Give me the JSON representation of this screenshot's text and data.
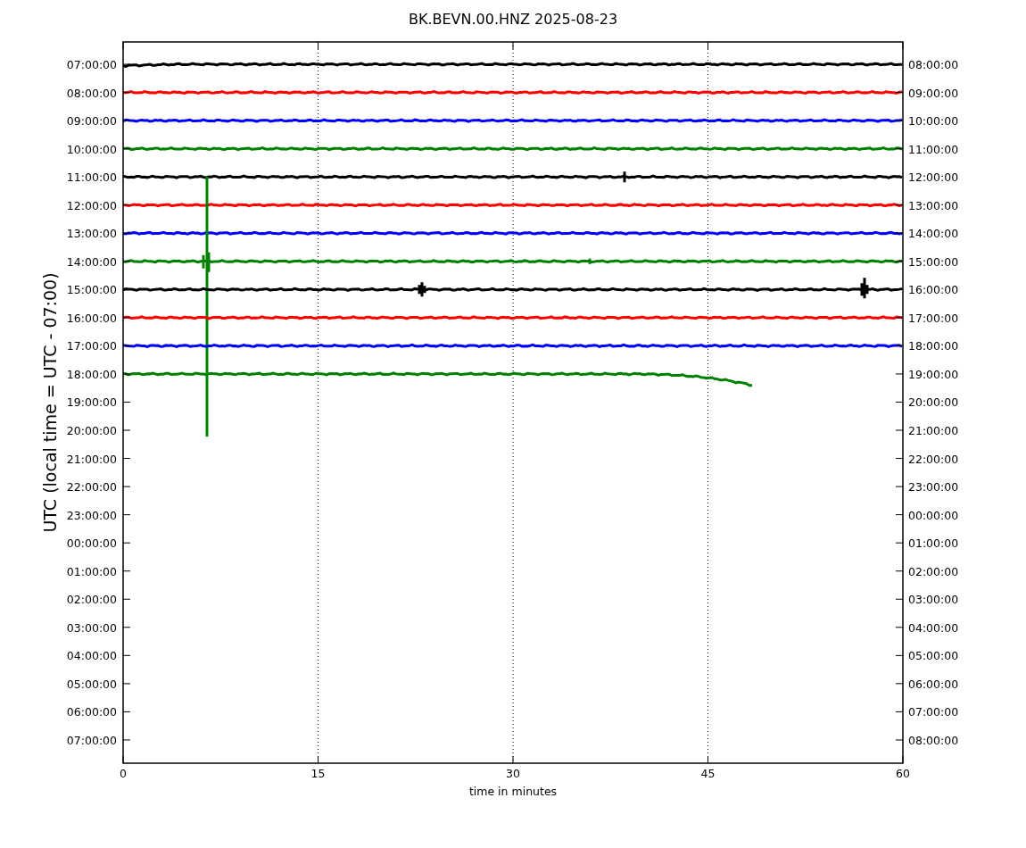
{
  "plot": {
    "title": "BK.BEVN.00.HNZ 2025-08-23",
    "ylabel": "UTC (local time = UTC - 07:00)",
    "xlabel": "time in minutes",
    "xticks": [
      "0",
      "15",
      "30",
      "45",
      "60"
    ],
    "left_labels": [
      "07:00:00",
      "08:00:00",
      "09:00:00",
      "10:00:00",
      "11:00:00",
      "12:00:00",
      "13:00:00",
      "14:00:00",
      "15:00:00",
      "16:00:00",
      "17:00:00",
      "18:00:00",
      "19:00:00",
      "20:00:00",
      "21:00:00",
      "22:00:00",
      "23:00:00",
      "00:00:00",
      "01:00:00",
      "02:00:00",
      "03:00:00",
      "04:00:00",
      "05:00:00",
      "06:00:00",
      "07:00:00"
    ],
    "right_labels": [
      "08:00:00",
      "09:00:00",
      "10:00:00",
      "11:00:00",
      "12:00:00",
      "13:00:00",
      "14:00:00",
      "15:00:00",
      "16:00:00",
      "17:00:00",
      "18:00:00",
      "19:00:00",
      "20:00:00",
      "21:00:00",
      "22:00:00",
      "23:00:00",
      "00:00:00",
      "01:00:00",
      "02:00:00",
      "03:00:00",
      "04:00:00",
      "05:00:00",
      "06:00:00",
      "07:00:00",
      "08:00:00"
    ],
    "traces": [
      {
        "color": "#000000"
      },
      {
        "color": "#ff0000"
      },
      {
        "color": "#0000ff"
      },
      {
        "color": "#008000"
      },
      {
        "color": "#000000"
      },
      {
        "color": "#ff0000"
      },
      {
        "color": "#0000ff"
      },
      {
        "color": "#008000"
      },
      {
        "color": "#000000"
      },
      {
        "color": "#ff0000"
      },
      {
        "color": "#0000ff"
      },
      {
        "color": "#008000"
      }
    ]
  }
}
